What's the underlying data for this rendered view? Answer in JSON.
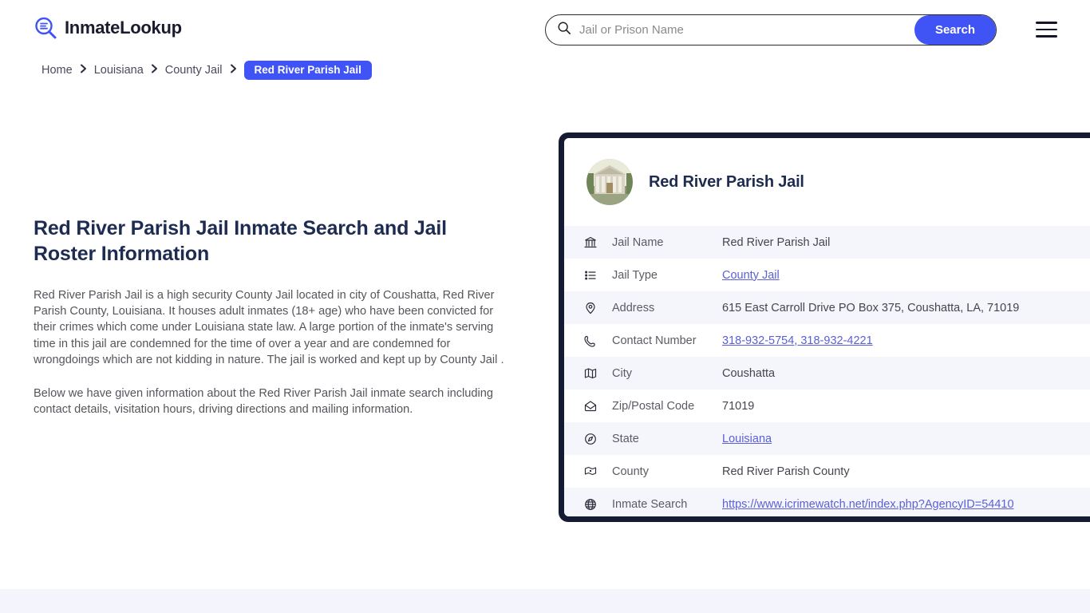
{
  "header": {
    "brand_name": "InmateLookup",
    "brand_icon": "magnifier-list-icon",
    "search": {
      "placeholder": "Jail or Prison Name",
      "value": "",
      "icon": "search-icon",
      "button_label": "Search"
    },
    "menu_icon": "hamburger-menu-icon",
    "accent_color": "#4054f5"
  },
  "breadcrumb": {
    "items": [
      {
        "label": "Home",
        "current": false
      },
      {
        "label": "Louisiana",
        "current": false
      },
      {
        "label": "County Jail",
        "current": false
      },
      {
        "label": "Red River Parish Jail",
        "current": true
      }
    ]
  },
  "main": {
    "title": "Red River Parish Jail Inmate Search and Jail Roster Information",
    "paragraphs": [
      "Red River Parish Jail is a high security County Jail located in city of Coushatta, Red River Parish County, Louisiana. It houses adult inmates (18+ age) who have been convicted for their crimes which come under Louisiana state law. A large portion of the inmate's serving time in this jail are condemned for the time of over a year and are condemned for wrongdoings which are not kidding in nature. The jail is worked and kept up by County Jail .",
      "Below we have given information about the Red River Parish Jail inmate search including contact details, visitation hours, driving directions and mailing information."
    ]
  },
  "card": {
    "title": "Red River Parish Jail",
    "thumbnail_icon": "courthouse-photo",
    "border_color": "#141b33",
    "rows": [
      {
        "icon": "bank-icon",
        "label": "Jail Name",
        "value": "Red River Parish Jail",
        "link": false
      },
      {
        "icon": "list-icon",
        "label": "Jail Type",
        "value": "County Jail",
        "link": true
      },
      {
        "icon": "map-pin-icon",
        "label": "Address",
        "value": "615 East Carroll Drive PO Box 375, Coushatta, LA, 71019",
        "link": false
      },
      {
        "icon": "phone-icon",
        "label": "Contact Number",
        "value": "318-932-5754, 318-932-4221",
        "link": true
      },
      {
        "icon": "map-icon",
        "label": "City",
        "value": "Coushatta",
        "link": false
      },
      {
        "icon": "envelope-icon",
        "label": "Zip/Postal Code",
        "value": "71019",
        "link": false
      },
      {
        "icon": "globe-compass-icon",
        "label": "State",
        "value": "Louisiana",
        "link": true
      },
      {
        "icon": "map-point-icon",
        "label": "County",
        "value": "Red River Parish County",
        "link": false
      },
      {
        "icon": "globe-icon",
        "label": "Inmate Search",
        "value": "https://www.icrimewatch.net/index.php?AgencyID=54410",
        "link": true
      }
    ]
  }
}
